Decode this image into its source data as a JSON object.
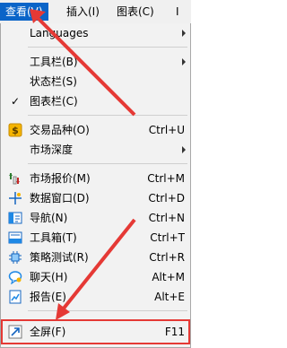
{
  "menubar": {
    "view": "查看(V)",
    "insert": "插入(I)",
    "charts": "图表(C)",
    "tools": "I"
  },
  "menu": {
    "languages": "Languages",
    "toolbars": "工具栏(B)",
    "status_bar": "状态栏(S)",
    "charts_bar": "图表栏(C)",
    "symbols": "交易品种(O)",
    "symbols_shortcut": "Ctrl+U",
    "market_depth": "市场深度",
    "market_watch": "市场报价(M)",
    "market_watch_shortcut": "Ctrl+M",
    "data_window": "数据窗口(D)",
    "data_window_shortcut": "Ctrl+D",
    "navigator": "导航(N)",
    "navigator_shortcut": "Ctrl+N",
    "toolbox": "工具箱(T)",
    "toolbox_shortcut": "Ctrl+T",
    "strategy_tester": "策略测试(R)",
    "strategy_tester_shortcut": "Ctrl+R",
    "chat": "聊天(H)",
    "chat_shortcut": "Alt+M",
    "reports": "报告(E)",
    "reports_shortcut": "Alt+E",
    "fullscreen": "全屏(F)",
    "fullscreen_shortcut": "F11"
  },
  "colors": {
    "menu_highlight": "#0a64c8",
    "annotation_red": "#e53935"
  }
}
